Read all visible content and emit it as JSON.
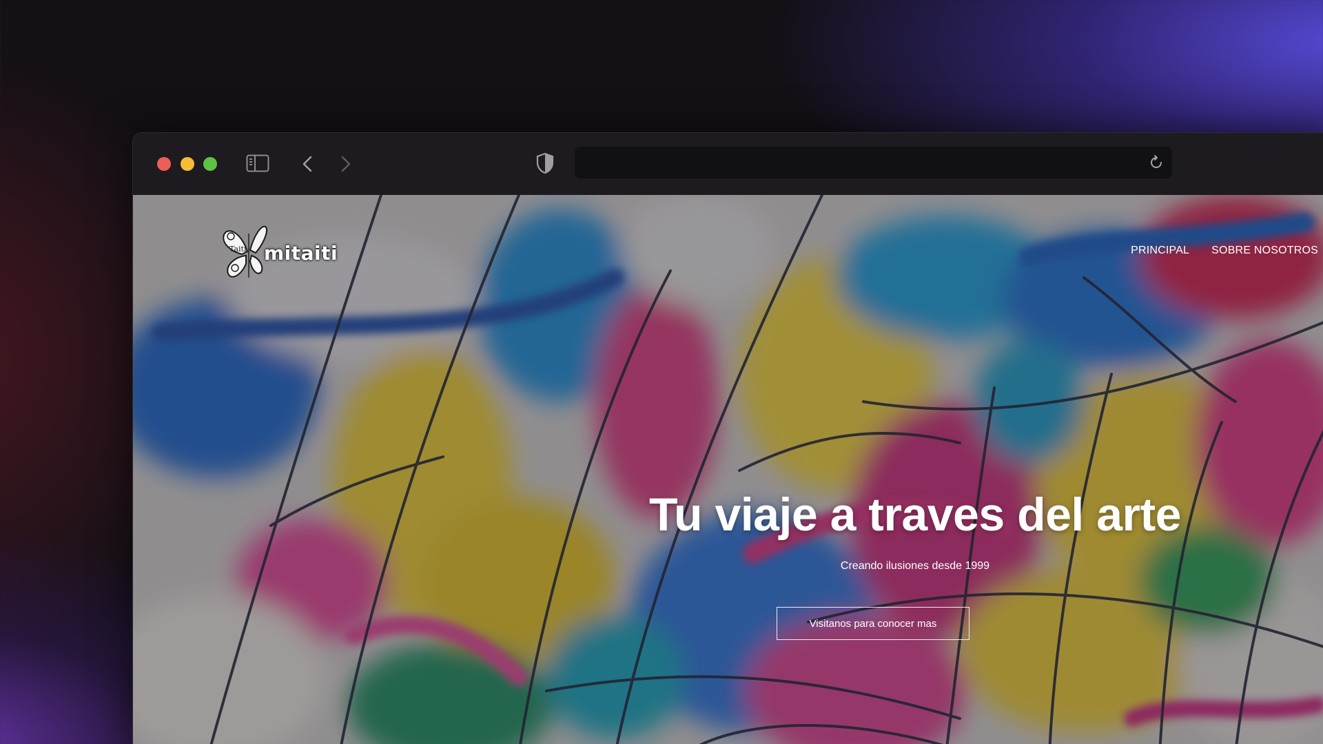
{
  "browser": {
    "address_text": "",
    "colors": {
      "close": "#ed5f55",
      "minimize": "#f4bd35",
      "maximize": "#5fc245"
    },
    "icons": [
      "sidebar-icon",
      "back-icon",
      "forward-icon",
      "shield-icon",
      "reload-icon"
    ]
  },
  "site": {
    "logo": {
      "wordmark": "mitaiti",
      "emblem_text": "Taiti",
      "icon": "butterfly-logo-icon"
    },
    "nav": [
      {
        "label": "PRINCIPAL"
      },
      {
        "label": "SOBRE NOSOTROS"
      }
    ],
    "hero": {
      "title": "Tu viaje a traves del arte",
      "subtitle": "Creando ilusiones desde 1999",
      "button_label": "Visitanos para conocer mas"
    }
  }
}
